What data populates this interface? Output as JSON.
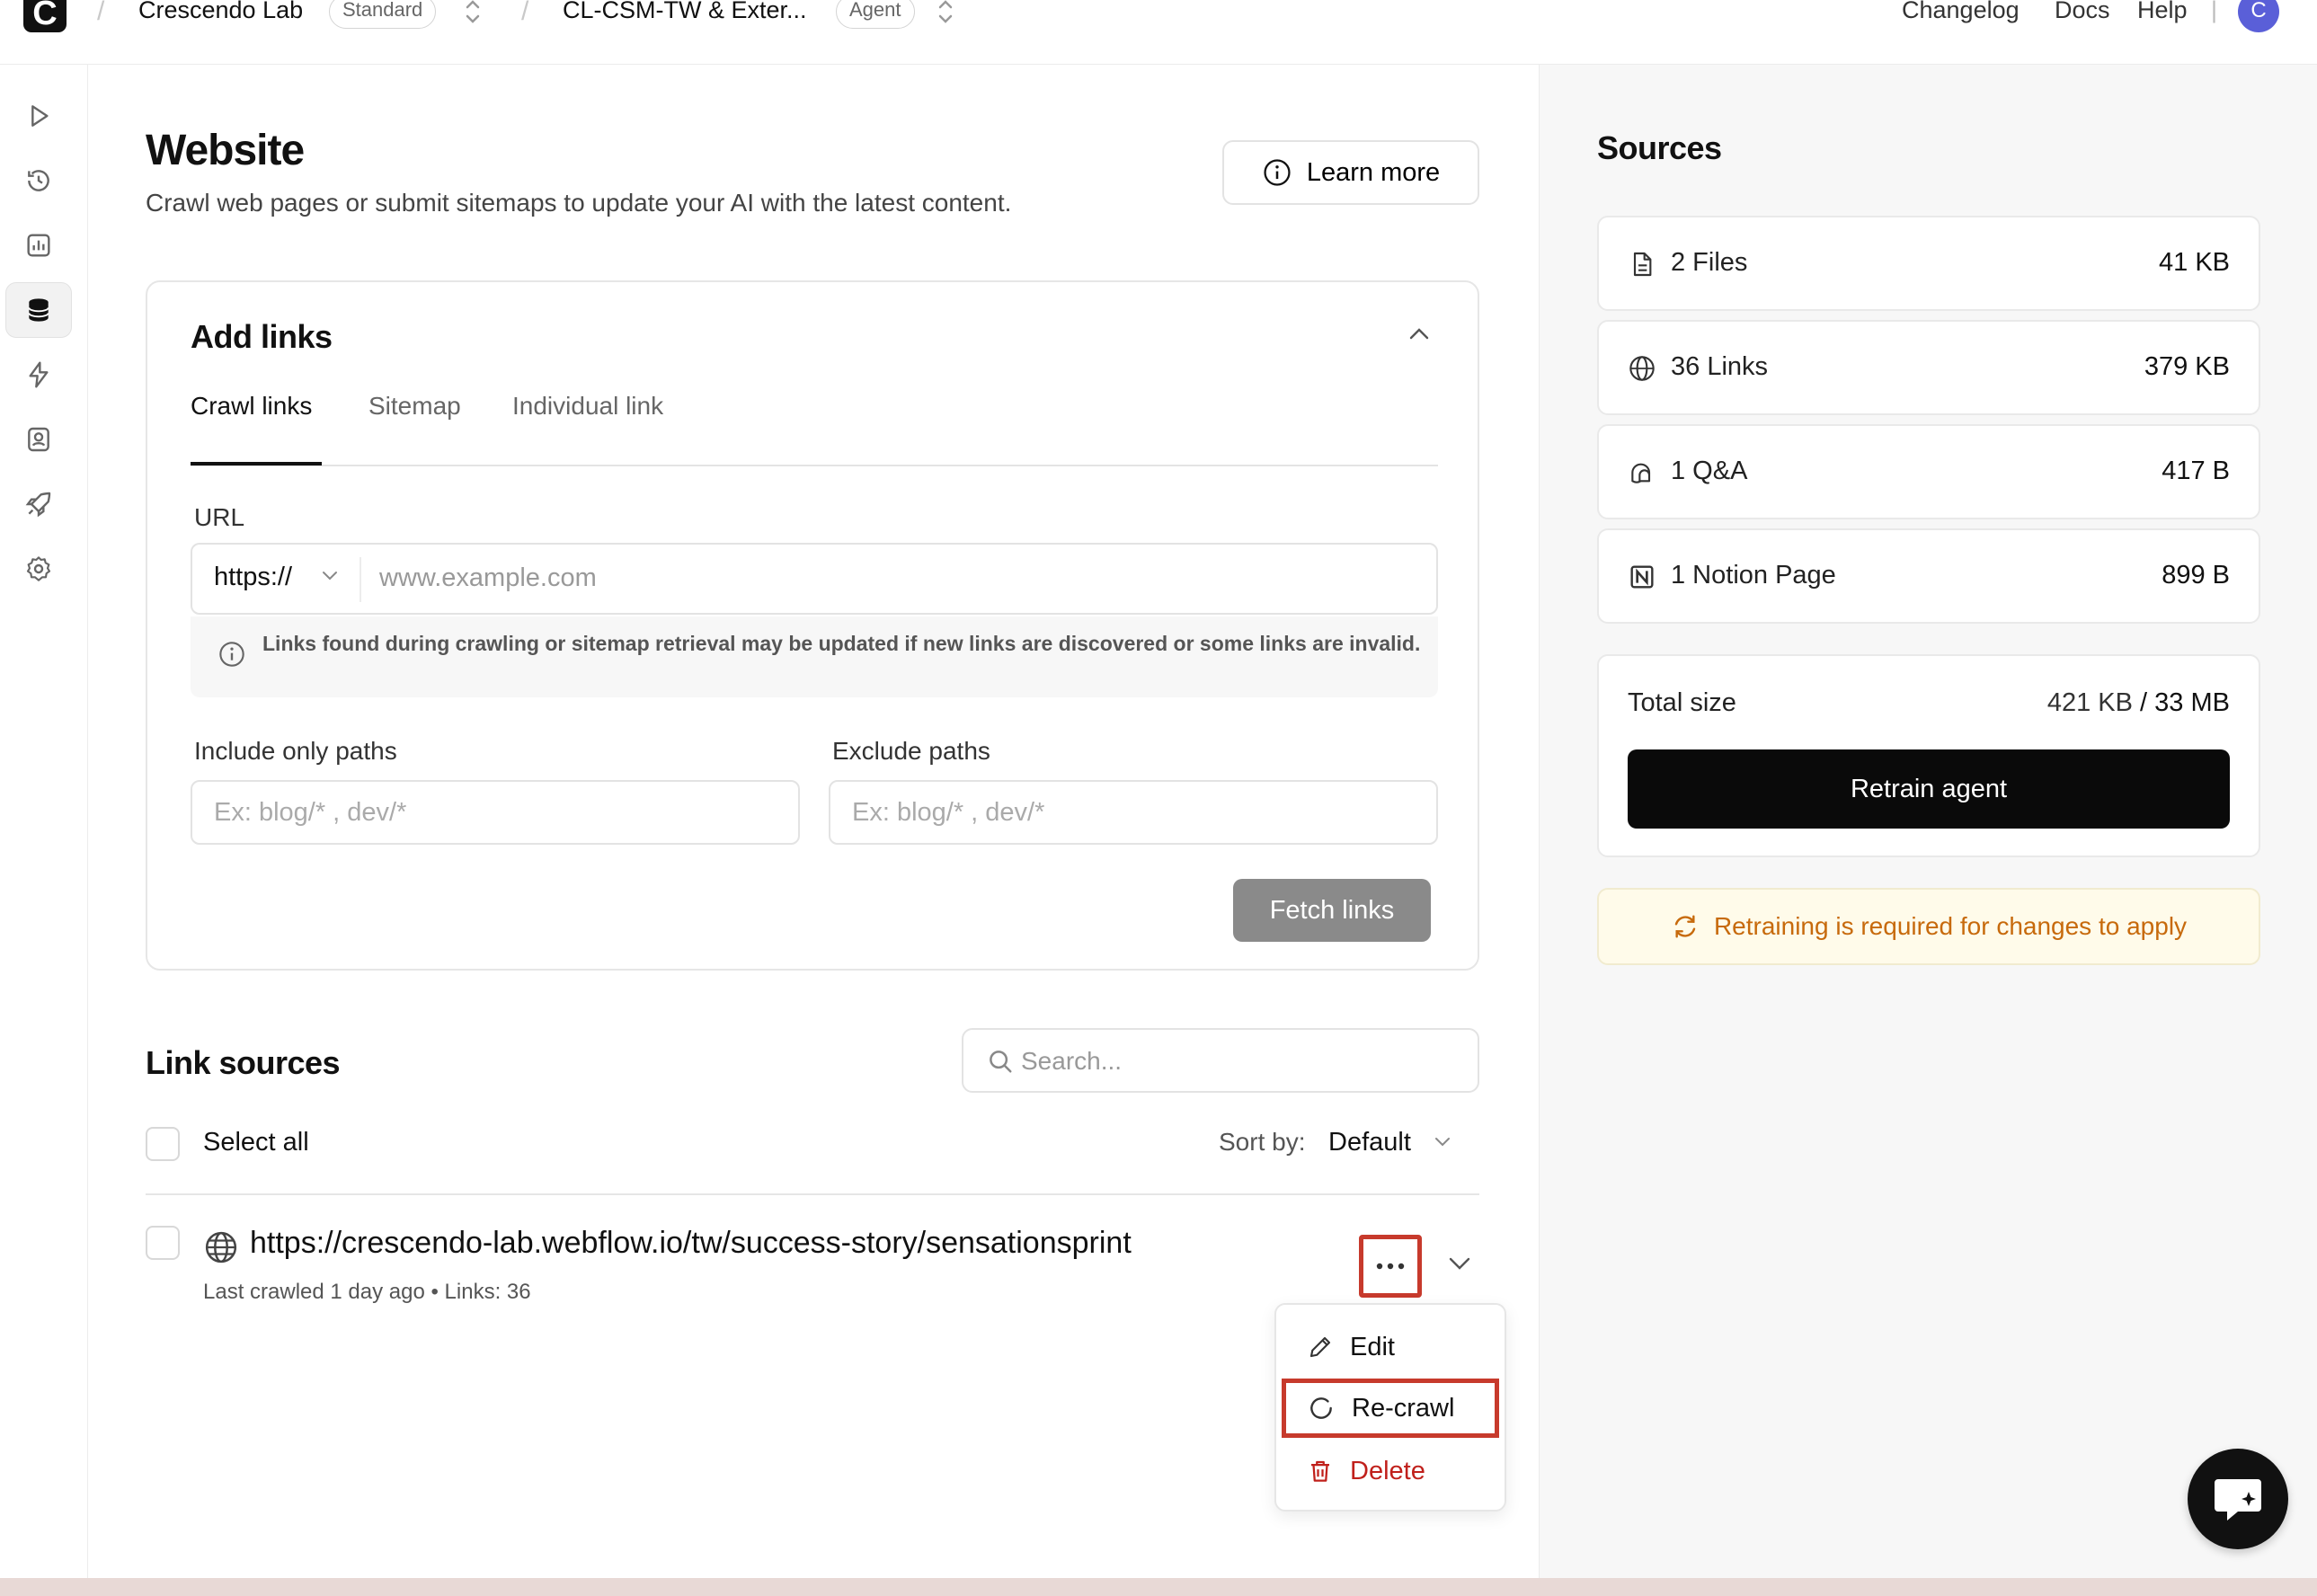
{
  "topbar": {
    "workspace": "Crescendo Lab",
    "workspace_plan": "Standard",
    "agent": "CL-CSM-TW & Exter...",
    "agent_type": "Agent",
    "links": [
      "Changelog",
      "Docs",
      "Help"
    ],
    "avatar_initial": "C",
    "logo_letter": "C"
  },
  "sidebar": {
    "icons": [
      "play-icon",
      "history-icon",
      "analytics-icon",
      "database-icon",
      "integrations-icon",
      "contacts-icon",
      "deploy-icon",
      "settings-icon"
    ],
    "active": "database-icon"
  },
  "page": {
    "title": "Website",
    "subtitle": "Crawl web pages or submit sitemaps to update your AI with the latest content.",
    "learn_more": "Learn more"
  },
  "add_links": {
    "title": "Add links",
    "tabs": [
      "Crawl links",
      "Sitemap",
      "Individual link"
    ],
    "active_tab": "Crawl links",
    "url_label": "URL",
    "protocol": "https://",
    "url_placeholder": "www.example.com",
    "info": "Links found during crawling or sitemap retrieval may be updated if new links are discovered or some links are invalid.",
    "include_label": "Include only paths",
    "include_placeholder": "Ex: blog/* , dev/*",
    "exclude_label": "Exclude paths",
    "exclude_placeholder": "Ex: blog/* , dev/*",
    "fetch_button": "Fetch links"
  },
  "link_sources": {
    "title": "Link sources",
    "search_placeholder": "Search...",
    "select_all": "Select all",
    "sort_label": "Sort by:",
    "sort_value": "Default",
    "rows": [
      {
        "url": "https://crescendo-lab.webflow.io/tw/success-story/sensationsprint",
        "meta": "Last crawled 1 day ago • Links: 36"
      }
    ],
    "menu": {
      "edit": "Edit",
      "recrawl": "Re-crawl",
      "delete": "Delete"
    }
  },
  "sources": {
    "title": "Sources",
    "items": [
      {
        "label": "2 Files",
        "size": "41 KB",
        "icon": "file-icon"
      },
      {
        "label": "36 Links",
        "size": "379 KB",
        "icon": "globe-icon"
      },
      {
        "label": "1 Q&A",
        "size": "417 B",
        "icon": "qa-icon"
      },
      {
        "label": "1 Notion Page",
        "size": "899 B",
        "icon": "notion-icon"
      }
    ],
    "total_label": "Total size",
    "total_used": "421 KB",
    "total_sep": " / ",
    "total_limit": "33 MB",
    "retrain_button": "Retrain agent",
    "warning": "Retraining is required for changes to apply"
  },
  "colors": {
    "accent_red": "#c73a2c",
    "warning_text": "#c76a0c",
    "warning_bg": "#fffbea",
    "primary_button": "#0a0a0a",
    "avatar": "#5a5fd8"
  }
}
